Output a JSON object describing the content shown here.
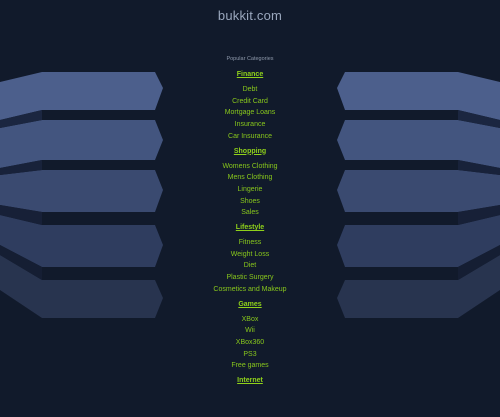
{
  "site": {
    "title": "bukkit.com"
  },
  "categories_block": {
    "label": "Popular Categories",
    "categories": [
      {
        "name": "Finance",
        "links": [
          "Debt",
          "Credit Card",
          "Mortgage Loans",
          "Insurance",
          "Car Insurance"
        ]
      },
      {
        "name": "Shopping",
        "links": [
          "Womens Clothing",
          "Mens Clothing",
          "Lingerie",
          "Shoes",
          "Sales"
        ]
      },
      {
        "name": "Lifestyle",
        "links": [
          "Fitness",
          "Weight Loss",
          "Diet",
          "Plastic Surgery",
          "Cosmetics and Makeup"
        ]
      },
      {
        "name": "Games",
        "links": [
          "XBox",
          "Wii",
          "XBox360",
          "PS3",
          "Free games"
        ]
      },
      {
        "name": "Internet",
        "links": []
      }
    ]
  },
  "colors": {
    "background": "#111a2b",
    "link": "#88c71c",
    "heading": "#8fd11a",
    "title": "#9aa7bd"
  }
}
